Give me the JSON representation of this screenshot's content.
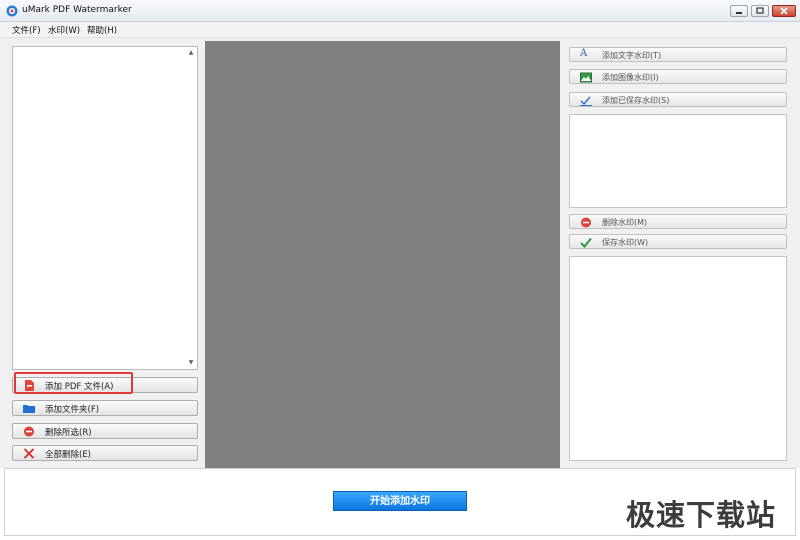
{
  "window": {
    "title": "uMark PDF Watermarker"
  },
  "menu": [
    {
      "label": "文件(F)"
    },
    {
      "label": "水印(W)"
    },
    {
      "label": "帮助(H)"
    }
  ],
  "left_panel": {
    "add_pdf_label": "添加 PDF 文件(A)",
    "add_folder_label": "添加文件夹(F)",
    "delete_selected_label": "删除所选(R)",
    "delete_all_label": "全部删除(E)"
  },
  "right_panel": {
    "add_text_label": "添加文字水印(T)",
    "add_image_label": "添加图像水印(I)",
    "add_saved_label": "添加已保存水印(S)",
    "delete_wm_label": "删除水印(M)",
    "save_wm_label": "保存水印(W)"
  },
  "start_button": {
    "label": "开始添加水印"
  },
  "site_watermark": "极速下载站",
  "colors": {
    "accent": "#1a86ec",
    "highlight": "#e0393b",
    "preview_bg": "#808080"
  }
}
